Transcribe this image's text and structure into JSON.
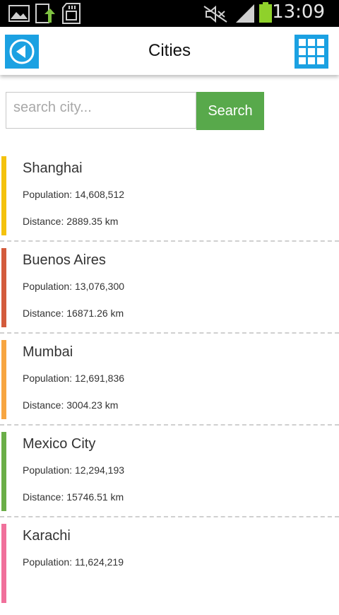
{
  "status_bar": {
    "time": "13:09",
    "icons": [
      "image-icon",
      "upload-icon",
      "sd-card-icon",
      "mute-icon",
      "signal-icon",
      "battery-icon"
    ],
    "battery_color": "#8fd12b"
  },
  "app_bar": {
    "title": "Cities",
    "back_icon": "back-arrow-icon",
    "grid_icon": "grid-icon",
    "accent": "#1ba1e2"
  },
  "search": {
    "placeholder": "search city...",
    "value": "",
    "button_label": "Search",
    "button_color": "#58a94b"
  },
  "cities": [
    {
      "name": "Shanghai",
      "population": "Population: 14,608,512",
      "distance": "Distance: 2889.35 km",
      "color": "#f4c20d"
    },
    {
      "name": "Buenos Aires",
      "population": "Population: 13,076,300",
      "distance": "Distance: 16871.26 km",
      "color": "#d35b3c"
    },
    {
      "name": "Mumbai",
      "population": "Population: 12,691,836",
      "distance": "Distance: 3004.23 km",
      "color": "#f7a541"
    },
    {
      "name": "Mexico City",
      "population": "Population: 12,294,193",
      "distance": "Distance: 15746.51 km",
      "color": "#6aae47"
    },
    {
      "name": "Karachi",
      "population": "Population: 11,624,219",
      "distance": "",
      "color": "#f0709b"
    }
  ]
}
